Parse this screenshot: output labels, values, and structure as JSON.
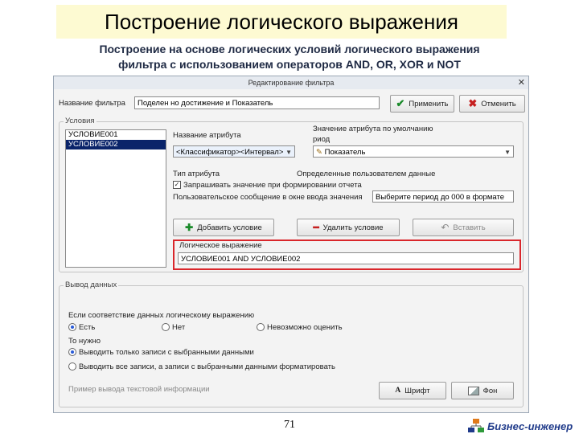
{
  "slide": {
    "title": "Построение логического выражения",
    "subtitle_line1": "Построение на основе логических условий логического выражения",
    "subtitle_line2": "фильтра с использованием операторов AND, OR, XOR и NOT",
    "page_number": "71",
    "brand": "Бизнес-инженер"
  },
  "dialog": {
    "title": "Редактирование фильтра",
    "filter_name_label": "Название фильтра",
    "filter_name_value": "Поделен но достижение и Показатель",
    "apply_button": "Применить",
    "cancel_button": "Отменить",
    "conditions": {
      "group_title": "Условия",
      "items": [
        "УСЛОВИЕ001",
        "УСЛОВИЕ002"
      ],
      "attribute_name_label": "Название атрибута",
      "attribute_name_value": "<Классификатор><Интервал>",
      "default_value_label_line1": "Значение атрибута по умолчанию",
      "default_value_label_line2": "риод",
      "default_value": "Показатель",
      "attribute_type_label": "Тип атрибута",
      "attribute_type_value": "Определенные пользователем данные",
      "ask_checkbox_label": "Запрашивать значение при формировании отчета",
      "user_message_label": "Пользовательское сообщение в окне ввода значения",
      "user_message_value": "Выберите период до 000 в формате",
      "add_condition_button": "Добавить условие",
      "delete_condition_button": "Удалить условие",
      "edit_button": "Вставить",
      "logic_expression_label": "Логическое выражение",
      "logic_expression_value": "УСЛОВИЕ001 AND УСЛОВИЕ002"
    },
    "output": {
      "group_title": "Вывод данных",
      "question": "Если соответствие данных логическому выражению",
      "radio_yes": "Есть",
      "radio_no": "Нет",
      "radio_unknown": "Невозможно оценить",
      "then_label": "То нужно",
      "option1": "Выводить только записи с выбранными данными",
      "option2": "Выводить все записи, а записи с выбранными данными форматировать",
      "sample_text": "Пример вывода текстовой информации",
      "font_button": "Шрифт",
      "background_button": "Фон"
    }
  },
  "colors": {
    "title_bg": "#fdfad2",
    "highlight": "#d9262b",
    "selection": "#0a246a",
    "brand": "#1f3a8a"
  }
}
